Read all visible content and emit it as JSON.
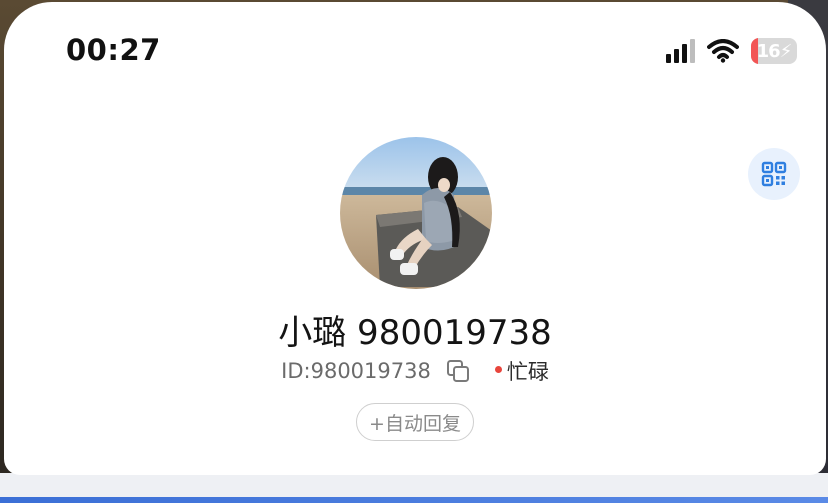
{
  "status_bar": {
    "time": "00:27",
    "battery": "16",
    "battery_level_fraction": 0.16,
    "battery_color": "#f25555",
    "signal_bars_active": 3,
    "signal_bars_total": 4,
    "icons": [
      "cellular-signal-icon",
      "wifi-icon",
      "battery-charging-icon"
    ]
  },
  "profile": {
    "name": "小璐 980019738",
    "id_text": "ID:980019738",
    "status": "忙碌",
    "status_color": "#e8453c",
    "auto_reply_label": "+自动回复",
    "avatar_icon": "profile-photo",
    "accent_color": "#2f7fe0"
  },
  "actions": {
    "qr_icon": "qr-code-icon",
    "copy_icon": "copy-icon"
  }
}
